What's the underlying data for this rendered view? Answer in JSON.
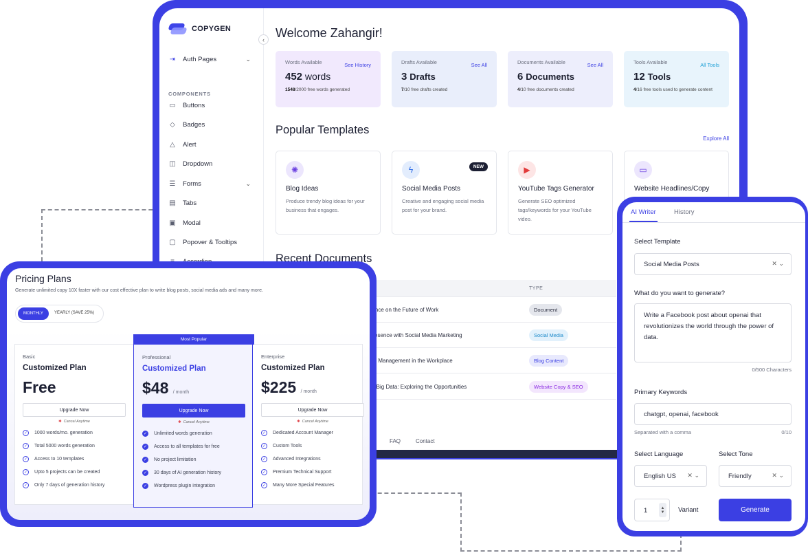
{
  "app": {
    "logo_text": "COPYGEN",
    "welcome": "Welcome Zahangir!"
  },
  "sidebar": {
    "auth_pages": "Auth Pages",
    "section": "COMPONENTS",
    "items": [
      {
        "label": "Buttons",
        "icon": "buttons-icon"
      },
      {
        "label": "Badges",
        "icon": "badge-icon"
      },
      {
        "label": "Alert",
        "icon": "alert-icon"
      },
      {
        "label": "Dropdown",
        "icon": "dropdown-icon"
      },
      {
        "label": "Forms",
        "icon": "forms-icon"
      },
      {
        "label": "Tabs",
        "icon": "tabs-icon"
      },
      {
        "label": "Modal",
        "icon": "modal-icon"
      },
      {
        "label": "Popover & Tooltips",
        "icon": "popover-icon"
      },
      {
        "label": "Accordion",
        "icon": "accordion-icon"
      }
    ]
  },
  "stats": [
    {
      "label": "Words Available",
      "link": "See History",
      "value": "452",
      "unit": "words",
      "sub_bold": "1548",
      "sub": "/2000 free words generated",
      "bg": "#f1e9fd"
    },
    {
      "label": "Drafts Available",
      "link": "See All",
      "value": "3",
      "unit": "Drafts",
      "sub_bold": "7",
      "sub": "/10 free drafts created",
      "bg": "#e9eefb"
    },
    {
      "label": "Documents Available",
      "link": "See All",
      "value": "6",
      "unit": "Documents",
      "sub_bold": "4",
      "sub": "/10 free documents created",
      "bg": "#edeefc"
    },
    {
      "label": "Tools Available",
      "link": "All Tools",
      "value": "12",
      "unit": "Tools",
      "sub_bold": "4",
      "sub": "/16 free tools used to generate content",
      "bg": "#e8f4fc"
    }
  ],
  "templates": {
    "title": "Popular Templates",
    "explore": "Explore All",
    "new_badge": "NEW",
    "items": [
      {
        "title": "Blog Ideas",
        "desc": "Produce trendy blog ideas for your business that engages.",
        "icon": "lightbulb-icon"
      },
      {
        "title": "Social Media Posts",
        "desc": "Creative and engaging social media post for your brand.",
        "icon": "lightning-icon"
      },
      {
        "title": "YouTube Tags Generator",
        "desc": "Generate SEO optimized tags/keywords for your YouTube video.",
        "icon": "youtube-icon"
      },
      {
        "title": "Website Headlines/Copy",
        "desc": "",
        "icon": "monitor-icon"
      }
    ]
  },
  "documents": {
    "title": "Recent Documents",
    "type_header": "TYPE",
    "rows": [
      {
        "name": "gence on the Future of Work",
        "type": "Document"
      },
      {
        "name": "Presence with Social Media Marketing",
        "type": "Social Media"
      },
      {
        "name": "me Management in the Workplace",
        "type": "Blog Content"
      },
      {
        "name": "ith Big Data: Exploring the Opportunities",
        "type": "Website Copy & SEO"
      }
    ]
  },
  "footer": {
    "link1": "cy",
    "link2": "FAQ",
    "link3": "Contact"
  },
  "pricing": {
    "title": "Pricing Plans",
    "subtitle": "Generate unlimited copy 10X faster with our cost effective plan to write blog posts, social media ads and many more.",
    "monthly": "MONTHLY",
    "yearly": "YEARLY (SAVE 25%)",
    "most_popular": "Most Popular",
    "cancel": "Cancel Anytime",
    "plans": [
      {
        "tier": "Basic",
        "name": "Customized Plan",
        "price": "Free",
        "per": "",
        "button": "Upgrade Now",
        "features": [
          "1000 words/mo. generation",
          "Total 5000 words generation",
          "Access to 10 templates",
          "Upto 5 projects can be created",
          "Only 7 days of generation history"
        ]
      },
      {
        "tier": "Professional",
        "name": "Customized Plan",
        "price": "$48",
        "per": "/ month",
        "button": "Upgrade Now",
        "features": [
          "Unlimited words generation",
          "Access to all templates for free",
          "No project limitation",
          "30 days of AI generation history",
          "Wordpress plugin integration"
        ]
      },
      {
        "tier": "Enterprise",
        "name": "Customized Plan",
        "price": "$225",
        "per": "/ month",
        "button": "Upgrade Now",
        "features": [
          "Dedicated Account Manager",
          "Custom Tools",
          "Advanced Integrations",
          "Premium Technical Support",
          "Many More Special Features"
        ]
      }
    ]
  },
  "ai_writer": {
    "tab_active": "AI Writer",
    "tab_history": "History",
    "template_label": "Select Template",
    "template_value": "Social Media Posts",
    "prompt_label": "What do you want to generate?",
    "prompt_value": "Write a Facebook post about openai that revolutionizes the world through the power of data.",
    "char_count": "0/500 Characters",
    "keywords_label": "Primary Keywords",
    "keywords_value": "chatgpt, openai, facebook",
    "keywords_hint": "Separated with a comma",
    "keywords_count": "0/10",
    "language_label": "Select Language",
    "language_value": "English US",
    "tone_label": "Select Tone",
    "tone_value": "Friendly",
    "variant_value": "1",
    "variant_label": "Variant",
    "generate": "Generate"
  },
  "colors": {
    "accent": "#3b3fe3",
    "dark": "#1c1f33"
  }
}
